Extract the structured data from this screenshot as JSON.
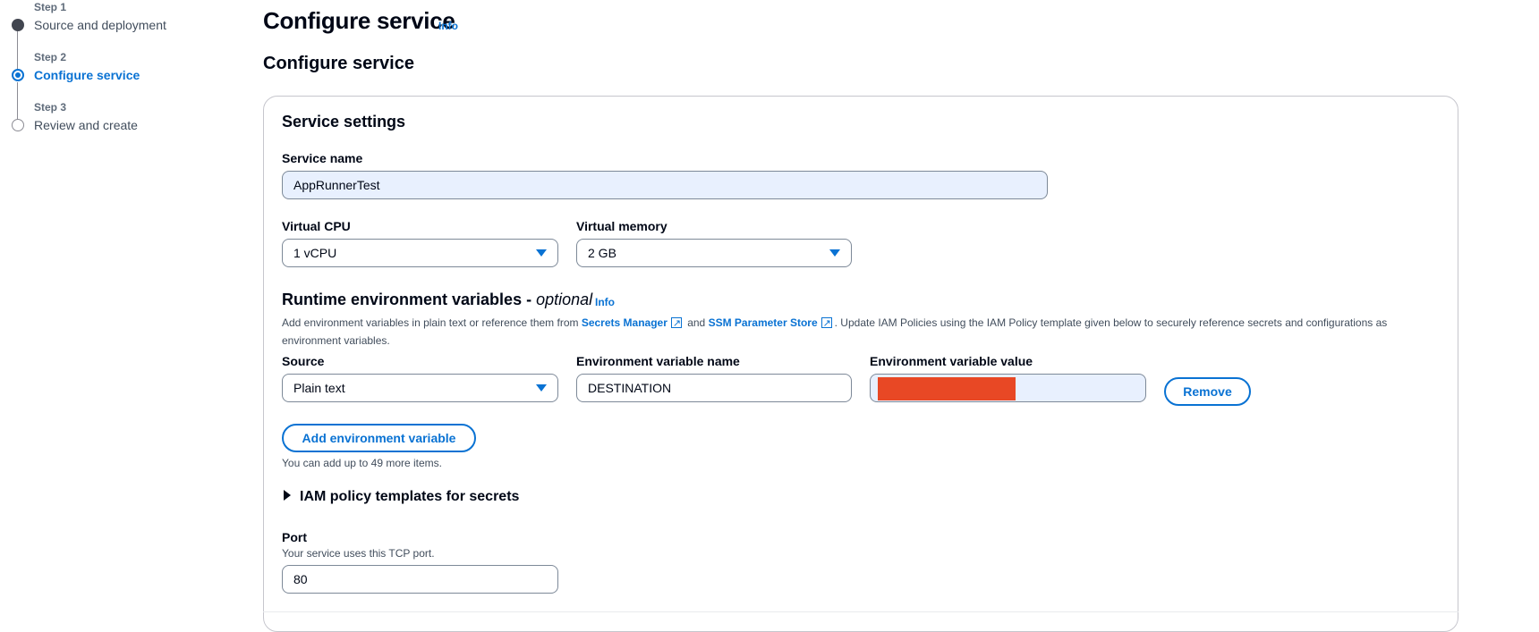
{
  "steps": [
    {
      "num": "Step 1",
      "title": "Source and deployment"
    },
    {
      "num": "Step 2",
      "title": "Configure service"
    },
    {
      "num": "Step 3",
      "title": "Review and create"
    }
  ],
  "page": {
    "title": "Configure service",
    "info": "Info",
    "section_title": "Configure service"
  },
  "service_settings": {
    "title": "Service settings",
    "service_name_label": "Service name",
    "service_name_value": "AppRunnerTest",
    "vcpu_label": "Virtual CPU",
    "vcpu_value": "1 vCPU",
    "memory_label": "Virtual memory",
    "memory_value": "2 GB"
  },
  "env": {
    "title": "Runtime environment variables - ",
    "title_optional": "optional",
    "info": "Info",
    "desc_1": "Add environment variables in plain text or reference them from ",
    "link_secrets": "Secrets Manager",
    "desc_and": " and ",
    "link_ssm": "SSM Parameter Store",
    "desc_2": ". Update IAM Policies using the IAM Policy template given below to securely reference secrets and configurations as environment variables.",
    "source_label": "Source",
    "source_value": "Plain text",
    "name_label": "Environment variable name",
    "name_value": "DESTINATION",
    "value_label": "Environment variable value",
    "remove_button": "Remove",
    "add_button": "Add environment variable",
    "limit_text": "You can add up to 49 more items."
  },
  "iam": {
    "expander_label": "IAM policy templates for secrets"
  },
  "port": {
    "label": "Port",
    "desc": "Your service uses this TCP port.",
    "value": "80"
  },
  "colors": {
    "accent": "#0972d3",
    "redaction": "#e84825",
    "autofill_bg": "#e8f0fe"
  }
}
